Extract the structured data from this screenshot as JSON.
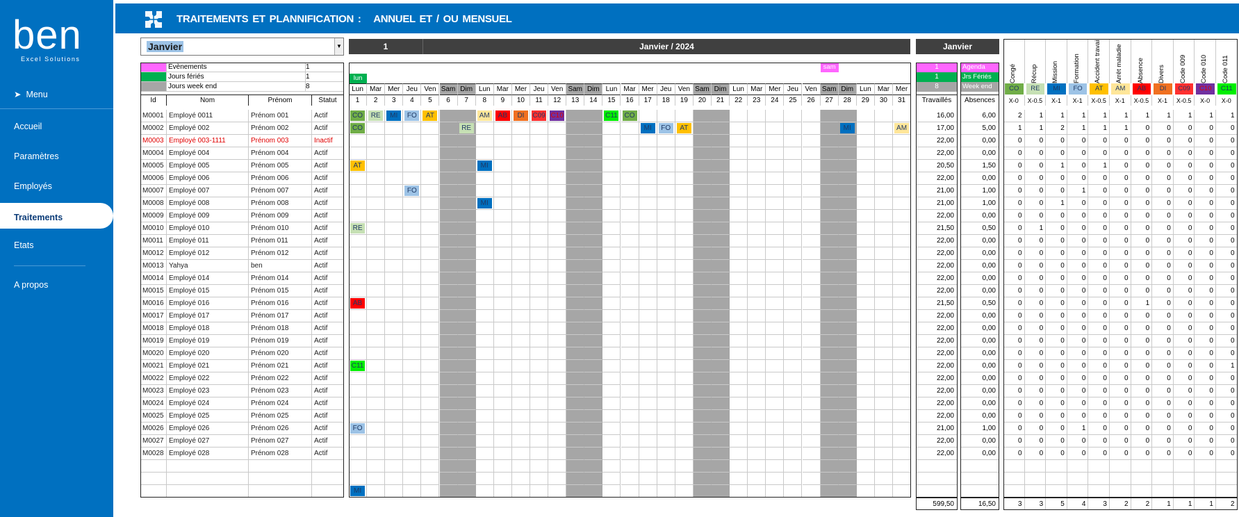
{
  "sidebar": {
    "brand": "ben",
    "tagline": "Excel Solutions",
    "menu_label": "Menu",
    "items": [
      {
        "label": "Accueil",
        "active": false
      },
      {
        "label": "Paramètres",
        "active": false
      },
      {
        "label": "Employés",
        "active": false
      },
      {
        "label": "Traitements",
        "active": true
      },
      {
        "label": "Etats",
        "active": false
      },
      {
        "label": "A propos",
        "active": false
      }
    ]
  },
  "header": {
    "title_left": "TRAITEMENTS  ET PLANNIFICATION   :",
    "title_right": "ANNUEL ET / OU MENSUEL"
  },
  "month_select": {
    "value": "Janvier"
  },
  "calendar": {
    "month_index": "1",
    "month_year": "Janvier / 2024",
    "month_name": "Janvier",
    "legend": [
      {
        "label": "Évènements",
        "value": "1",
        "color": "#ff66ff"
      },
      {
        "label": "Jours fériés",
        "value": "1",
        "color": "#00b050"
      },
      {
        "label": "Jours week end",
        "value": "8",
        "color": "#a6a6a6"
      }
    ],
    "event_label": "sam",
    "event_day": 27,
    "holiday_label": "lun",
    "holiday_day": 1,
    "summary_counts": [
      "1",
      "1",
      "8"
    ],
    "summary_labels": [
      "Agenda",
      "Jrs Fériés",
      "Week end"
    ],
    "col_headers": {
      "id": "Id",
      "nom": "Nom",
      "prenom": "Prénom",
      "statut": "Statut"
    },
    "weekdays": [
      "Lun",
      "Mar",
      "Mer",
      "Jeu",
      "Ven",
      "Sam",
      "Dim",
      "Lun",
      "Mar",
      "Mer",
      "Jeu",
      "Ven",
      "Sam",
      "Dim",
      "Lun",
      "Mar",
      "Mer",
      "Jeu",
      "Ven",
      "Sam",
      "Dim",
      "Lun",
      "Mar",
      "Mer",
      "Jeu",
      "Ven",
      "Sam",
      "Dim",
      "Lun",
      "Mar",
      "Mer"
    ],
    "weekend_days": [
      6,
      7,
      13,
      14,
      20,
      21,
      27,
      28
    ],
    "travailles_label": "Travaillés",
    "absences_label": "Absences",
    "total_travailles": "599,50",
    "total_absences": "16,50"
  },
  "codes": [
    {
      "name": "Congé",
      "code": "CO",
      "bg": "#70ad47",
      "fg": "#1f3864",
      "factor": "X-0"
    },
    {
      "name": "Récup",
      "code": "RE",
      "bg": "#c6e0b4",
      "fg": "#1f3864",
      "factor": "X-0.5"
    },
    {
      "name": "Mission",
      "code": "MI",
      "bg": "#0070c0",
      "fg": "#1f3864",
      "factor": "X-1"
    },
    {
      "name": "Formation",
      "code": "FO",
      "bg": "#9dc3e6",
      "fg": "#1f3864",
      "factor": "X-1"
    },
    {
      "name": "Accident travail",
      "code": "AT",
      "bg": "#ffc000",
      "fg": "#1f3864",
      "factor": "X-0.5"
    },
    {
      "name": "Arrêt maladie",
      "code": "AM",
      "bg": "#ffe699",
      "fg": "#1f3864",
      "factor": "X-1"
    },
    {
      "name": "Absence",
      "code": "AB",
      "bg": "#ff0000",
      "fg": "#1f3864",
      "factor": "X-0.5"
    },
    {
      "name": "Divers",
      "code": "DI",
      "bg": "#f07020",
      "fg": "#1f3864",
      "factor": "X-1"
    },
    {
      "name": "Code 009",
      "code": "C09",
      "bg": "#ff3030",
      "fg": "#1f3864",
      "factor": "X-0.5"
    },
    {
      "name": "Code 010",
      "code": "C10",
      "bg": "#7030a0",
      "fg": "#e00000",
      "factor": "X-0"
    },
    {
      "name": "Code 011",
      "code": "C11",
      "bg": "#00ee00",
      "fg": "#1f3864",
      "factor": "X-0"
    }
  ],
  "code_totals": [
    "3",
    "3",
    "5",
    "4",
    "3",
    "2",
    "2",
    "1",
    "1",
    "1",
    "2"
  ],
  "employees": [
    {
      "id": "M0001",
      "nom": "Employé 0011",
      "prenom": "Prénom 001",
      "statut": "Actif",
      "inactive": false,
      "marks": [
        [
          1,
          "CO"
        ],
        [
          2,
          "RE"
        ],
        [
          3,
          "MI"
        ],
        [
          4,
          "FO"
        ],
        [
          5,
          "AT"
        ],
        [
          8,
          "AM"
        ],
        [
          9,
          "AB"
        ],
        [
          10,
          "DI"
        ],
        [
          11,
          "C09"
        ],
        [
          12,
          "C10"
        ],
        [
          15,
          "C11"
        ],
        [
          16,
          "CO"
        ]
      ],
      "trav": "16,00",
      "abs": "6,00",
      "counts": [
        "2",
        "1",
        "1",
        "1",
        "1",
        "1",
        "1",
        "1",
        "1",
        "1",
        "1"
      ]
    },
    {
      "id": "M0002",
      "nom": "Employé 002",
      "prenom": "Prénom 002",
      "statut": "Actif",
      "inactive": false,
      "marks": [
        [
          1,
          "CO"
        ],
        [
          7,
          "RE"
        ],
        [
          17,
          "MI"
        ],
        [
          18,
          "FO"
        ],
        [
          19,
          "AT"
        ],
        [
          28,
          "MI"
        ],
        [
          31,
          "AM"
        ]
      ],
      "trav": "17,00",
      "abs": "5,00",
      "counts": [
        "1",
        "1",
        "2",
        "1",
        "1",
        "1",
        "0",
        "0",
        "0",
        "0",
        "0"
      ]
    },
    {
      "id": "M0003",
      "nom": "Employé 003-1111",
      "prenom": "Prénom 003",
      "statut": "Inactif",
      "inactive": true,
      "marks": [],
      "trav": "22,00",
      "abs": "0,00",
      "counts": [
        "0",
        "0",
        "0",
        "0",
        "0",
        "0",
        "0",
        "0",
        "0",
        "0",
        "0"
      ]
    },
    {
      "id": "M0004",
      "nom": "Employé 004",
      "prenom": "Prénom 004",
      "statut": "Actif",
      "inactive": false,
      "marks": [],
      "trav": "22,00",
      "abs": "0,00",
      "counts": [
        "0",
        "0",
        "0",
        "0",
        "0",
        "0",
        "0",
        "0",
        "0",
        "0",
        "0"
      ]
    },
    {
      "id": "M0005",
      "nom": "Employé 005",
      "prenom": "Prénom 005",
      "statut": "Actif",
      "inactive": false,
      "marks": [
        [
          1,
          "AT"
        ],
        [
          8,
          "MI"
        ]
      ],
      "trav": "20,50",
      "abs": "1,50",
      "counts": [
        "0",
        "0",
        "1",
        "0",
        "1",
        "0",
        "0",
        "0",
        "0",
        "0",
        "0"
      ]
    },
    {
      "id": "M0006",
      "nom": "Employé 006",
      "prenom": "Prénom 006",
      "statut": "Actif",
      "inactive": false,
      "marks": [],
      "trav": "22,00",
      "abs": "0,00",
      "counts": [
        "0",
        "0",
        "0",
        "0",
        "0",
        "0",
        "0",
        "0",
        "0",
        "0",
        "0"
      ]
    },
    {
      "id": "M0007",
      "nom": "Employé 007",
      "prenom": "Prénom 007",
      "statut": "Actif",
      "inactive": false,
      "marks": [
        [
          4,
          "FO"
        ]
      ],
      "trav": "21,00",
      "abs": "1,00",
      "counts": [
        "0",
        "0",
        "0",
        "1",
        "0",
        "0",
        "0",
        "0",
        "0",
        "0",
        "0"
      ]
    },
    {
      "id": "M0008",
      "nom": "Employé 008",
      "prenom": "Prénom 008",
      "statut": "Actif",
      "inactive": false,
      "marks": [
        [
          8,
          "MI"
        ]
      ],
      "trav": "21,00",
      "abs": "1,00",
      "counts": [
        "0",
        "0",
        "1",
        "0",
        "0",
        "0",
        "0",
        "0",
        "0",
        "0",
        "0"
      ]
    },
    {
      "id": "M0009",
      "nom": "Employé 009",
      "prenom": "Prénom 009",
      "statut": "Actif",
      "inactive": false,
      "marks": [],
      "trav": "22,00",
      "abs": "0,00",
      "counts": [
        "0",
        "0",
        "0",
        "0",
        "0",
        "0",
        "0",
        "0",
        "0",
        "0",
        "0"
      ]
    },
    {
      "id": "M0010",
      "nom": "Employé 010",
      "prenom": "Prénom 010",
      "statut": "Actif",
      "inactive": false,
      "marks": [
        [
          1,
          "RE"
        ]
      ],
      "trav": "21,50",
      "abs": "0,50",
      "counts": [
        "0",
        "1",
        "0",
        "0",
        "0",
        "0",
        "0",
        "0",
        "0",
        "0",
        "0"
      ]
    },
    {
      "id": "M0011",
      "nom": "Employé 011",
      "prenom": "Prénom 011",
      "statut": "Actif",
      "inactive": false,
      "marks": [],
      "trav": "22,00",
      "abs": "0,00",
      "counts": [
        "0",
        "0",
        "0",
        "0",
        "0",
        "0",
        "0",
        "0",
        "0",
        "0",
        "0"
      ]
    },
    {
      "id": "M0012",
      "nom": "Employé 012",
      "prenom": "Prénom 012",
      "statut": "Actif",
      "inactive": false,
      "marks": [],
      "trav": "22,00",
      "abs": "0,00",
      "counts": [
        "0",
        "0",
        "0",
        "0",
        "0",
        "0",
        "0",
        "0",
        "0",
        "0",
        "0"
      ]
    },
    {
      "id": "M0013",
      "nom": "Yahya",
      "prenom": "ben",
      "statut": "Actif",
      "inactive": false,
      "marks": [],
      "trav": "22,00",
      "abs": "0,00",
      "counts": [
        "0",
        "0",
        "0",
        "0",
        "0",
        "0",
        "0",
        "0",
        "0",
        "0",
        "0"
      ]
    },
    {
      "id": "M0014",
      "nom": "Employé 014",
      "prenom": "Prénom 014",
      "statut": "Actif",
      "inactive": false,
      "marks": [],
      "trav": "22,00",
      "abs": "0,00",
      "counts": [
        "0",
        "0",
        "0",
        "0",
        "0",
        "0",
        "0",
        "0",
        "0",
        "0",
        "0"
      ]
    },
    {
      "id": "M0015",
      "nom": "Employé 015",
      "prenom": "Prénom 015",
      "statut": "Actif",
      "inactive": false,
      "marks": [],
      "trav": "22,00",
      "abs": "0,00",
      "counts": [
        "0",
        "0",
        "0",
        "0",
        "0",
        "0",
        "0",
        "0",
        "0",
        "0",
        "0"
      ]
    },
    {
      "id": "M0016",
      "nom": "Employé 016",
      "prenom": "Prénom 016",
      "statut": "Actif",
      "inactive": false,
      "marks": [
        [
          1,
          "AB"
        ]
      ],
      "trav": "21,50",
      "abs": "0,50",
      "counts": [
        "0",
        "0",
        "0",
        "0",
        "0",
        "0",
        "1",
        "0",
        "0",
        "0",
        "0"
      ]
    },
    {
      "id": "M0017",
      "nom": "Employé 017",
      "prenom": "Prénom 017",
      "statut": "Actif",
      "inactive": false,
      "marks": [],
      "trav": "22,00",
      "abs": "0,00",
      "counts": [
        "0",
        "0",
        "0",
        "0",
        "0",
        "0",
        "0",
        "0",
        "0",
        "0",
        "0"
      ]
    },
    {
      "id": "M0018",
      "nom": "Employé 018",
      "prenom": "Prénom 018",
      "statut": "Actif",
      "inactive": false,
      "marks": [],
      "trav": "22,00",
      "abs": "0,00",
      "counts": [
        "0",
        "0",
        "0",
        "0",
        "0",
        "0",
        "0",
        "0",
        "0",
        "0",
        "0"
      ]
    },
    {
      "id": "M0019",
      "nom": "Employé 019",
      "prenom": "Prénom 019",
      "statut": "Actif",
      "inactive": false,
      "marks": [],
      "trav": "22,00",
      "abs": "0,00",
      "counts": [
        "0",
        "0",
        "0",
        "0",
        "0",
        "0",
        "0",
        "0",
        "0",
        "0",
        "0"
      ]
    },
    {
      "id": "M0020",
      "nom": "Employé 020",
      "prenom": "Prénom 020",
      "statut": "Actif",
      "inactive": false,
      "marks": [],
      "trav": "22,00",
      "abs": "0,00",
      "counts": [
        "0",
        "0",
        "0",
        "0",
        "0",
        "0",
        "0",
        "0",
        "0",
        "0",
        "0"
      ]
    },
    {
      "id": "M0021",
      "nom": "Employé 021",
      "prenom": "Prénom 021",
      "statut": "Actif",
      "inactive": false,
      "marks": [
        [
          1,
          "C11"
        ]
      ],
      "trav": "22,00",
      "abs": "0,00",
      "counts": [
        "0",
        "0",
        "0",
        "0",
        "0",
        "0",
        "0",
        "0",
        "0",
        "0",
        "1"
      ]
    },
    {
      "id": "M0022",
      "nom": "Employé 022",
      "prenom": "Prénom 022",
      "statut": "Actif",
      "inactive": false,
      "marks": [],
      "trav": "22,00",
      "abs": "0,00",
      "counts": [
        "0",
        "0",
        "0",
        "0",
        "0",
        "0",
        "0",
        "0",
        "0",
        "0",
        "0"
      ]
    },
    {
      "id": "M0023",
      "nom": "Employé 023",
      "prenom": "Prénom 023",
      "statut": "Actif",
      "inactive": false,
      "marks": [],
      "trav": "22,00",
      "abs": "0,00",
      "counts": [
        "0",
        "0",
        "0",
        "0",
        "0",
        "0",
        "0",
        "0",
        "0",
        "0",
        "0"
      ]
    },
    {
      "id": "M0024",
      "nom": "Employé 024",
      "prenom": "Prénom 024",
      "statut": "Actif",
      "inactive": false,
      "marks": [],
      "trav": "22,00",
      "abs": "0,00",
      "counts": [
        "0",
        "0",
        "0",
        "0",
        "0",
        "0",
        "0",
        "0",
        "0",
        "0",
        "0"
      ]
    },
    {
      "id": "M0025",
      "nom": "Employé 025",
      "prenom": "Prénom 025",
      "statut": "Actif",
      "inactive": false,
      "marks": [],
      "trav": "22,00",
      "abs": "0,00",
      "counts": [
        "0",
        "0",
        "0",
        "0",
        "0",
        "0",
        "0",
        "0",
        "0",
        "0",
        "0"
      ]
    },
    {
      "id": "M0026",
      "nom": "Employé 026",
      "prenom": "Prénom 026",
      "statut": "Actif",
      "inactive": false,
      "marks": [
        [
          1,
          "FO"
        ]
      ],
      "trav": "21,00",
      "abs": "1,00",
      "counts": [
        "0",
        "0",
        "0",
        "1",
        "0",
        "0",
        "0",
        "0",
        "0",
        "0",
        "0"
      ]
    },
    {
      "id": "M0027",
      "nom": "Employé 027",
      "prenom": "Prénom 027",
      "statut": "Actif",
      "inactive": false,
      "marks": [],
      "trav": "22,00",
      "abs": "0,00",
      "counts": [
        "0",
        "0",
        "0",
        "0",
        "0",
        "0",
        "0",
        "0",
        "0",
        "0",
        "0"
      ]
    },
    {
      "id": "M0028",
      "nom": "Employé 028",
      "prenom": "Prénom 028",
      "statut": "Actif",
      "inactive": false,
      "marks": [],
      "trav": "22,00",
      "abs": "0,00",
      "counts": [
        "0",
        "0",
        "0",
        "0",
        "0",
        "0",
        "0",
        "0",
        "0",
        "0",
        "0"
      ]
    },
    {
      "id": "",
      "nom": "",
      "prenom": "",
      "statut": "",
      "inactive": false,
      "marks": [],
      "trav": "",
      "abs": "",
      "counts": [
        "",
        "",
        "",
        "",
        "",
        "",
        "",
        "",
        "",
        "",
        ""
      ]
    },
    {
      "id": "",
      "nom": "",
      "prenom": "",
      "statut": "",
      "inactive": false,
      "marks": [],
      "trav": "",
      "abs": "",
      "counts": [
        "",
        "",
        "",
        "",
        "",
        "",
        "",
        "",
        "",
        "",
        ""
      ]
    },
    {
      "id": "",
      "nom": "",
      "prenom": "",
      "statut": "",
      "inactive": false,
      "marks": [
        [
          1,
          "MI"
        ]
      ],
      "trav": "",
      "abs": "",
      "counts": [
        "",
        "",
        "",
        "",
        "",
        "",
        "",
        "",
        "",
        "",
        ""
      ]
    }
  ]
}
